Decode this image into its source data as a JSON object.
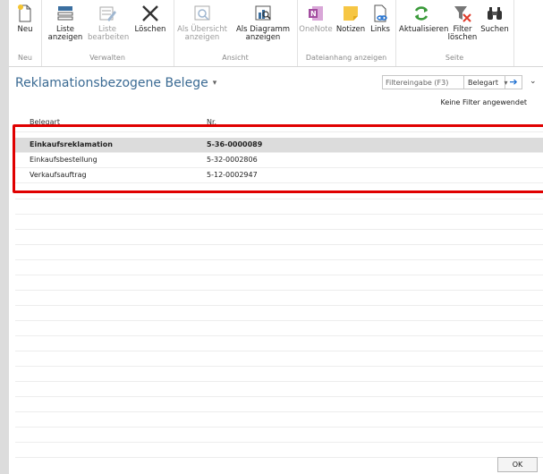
{
  "ribbon": {
    "groups": {
      "neu": "Neu",
      "verwalten": "Verwalten",
      "ansicht": "Ansicht",
      "dateianhang": "Dateianhang anzeigen",
      "seite": "Seite"
    },
    "buttons": {
      "neu": "Neu",
      "liste_anzeigen_1": "Liste",
      "liste_anzeigen_2": "anzeigen",
      "liste_bearbeiten_1": "Liste",
      "liste_bearbeiten_2": "bearbeiten",
      "loeschen": "Löschen",
      "als_uebersicht_1": "Als Übersicht",
      "als_uebersicht_2": "anzeigen",
      "als_diagramm_1": "Als Diagramm",
      "als_diagramm_2": "anzeigen",
      "onenote": "OneNote",
      "notizen": "Notizen",
      "links": "Links",
      "aktualisieren": "Aktualisieren",
      "filter_loeschen_1": "Filter",
      "filter_loeschen_2": "löschen",
      "suchen": "Suchen"
    }
  },
  "page": {
    "title": "Reklamationsbezogene Belege",
    "caret": "▾",
    "filter_placeholder": "Filtereingabe (F3)",
    "filter_field": "Belegart",
    "filter_field_caret": "▾",
    "go_symbol": "➔",
    "collapse_symbol": "⌄",
    "no_filter": "Keine Filter angewendet"
  },
  "table": {
    "columns": [
      "Belegart",
      "Nr."
    ],
    "rows": [
      {
        "belegart": "Einkaufsreklamation",
        "nr": "5-36-0000089"
      },
      {
        "belegart": "Einkaufsbestellung",
        "nr": "5-32-0002806"
      },
      {
        "belegart": "Verkaufsauftrag",
        "nr": "5-12-0002947"
      }
    ]
  },
  "footer": {
    "ok": "OK"
  },
  "colors": {
    "title": "#3a6a93",
    "highlight": "#e00000",
    "selected_row": "#dcdcdc"
  }
}
